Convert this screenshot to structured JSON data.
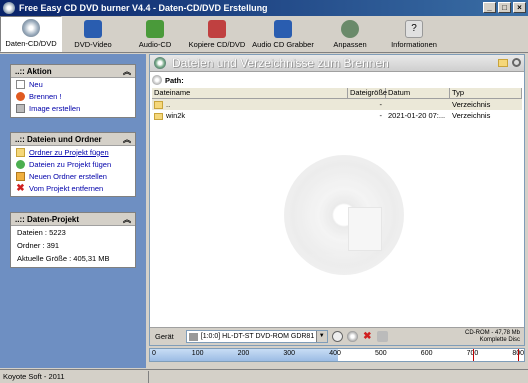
{
  "window": {
    "title": "Free Easy CD DVD burner V4.4 - Daten-CD/DVD Erstellung"
  },
  "toolbar": {
    "buttons": [
      {
        "label": "Daten-CD/DVD",
        "color": "#7a8fa8"
      },
      {
        "label": "DVD-Video",
        "color": "#2a5db0"
      },
      {
        "label": "Audio-CD",
        "color": "#4a9a3a"
      },
      {
        "label": "Kopiere CD/DVD",
        "color": "#c04040"
      },
      {
        "label": "Audio CD Grabber",
        "color": "#2a5db0"
      },
      {
        "label": "Anpassen",
        "color": "#6a8a6a"
      },
      {
        "label": "Informationen",
        "color": "#b0b0b0"
      }
    ]
  },
  "actions": {
    "title": "..:: Aktion",
    "items": [
      {
        "label": "Neu"
      },
      {
        "label": "Brennen !"
      },
      {
        "label": "Image erstellen"
      }
    ]
  },
  "files_folders": {
    "title": "..:: Dateien und Ordner",
    "items": [
      {
        "label": "Ordner zu Projekt fügen"
      },
      {
        "label": "Dateien zu Projekt fügen"
      },
      {
        "label": "Neuen Ordner erstellen"
      },
      {
        "label": "Vom Projekt entfernen"
      }
    ]
  },
  "project": {
    "title": "..:: Daten-Projekt",
    "files": "Dateien : 5223",
    "folders": "Ordner : 391",
    "size": "Aktuelle Größe : 405,31 MB"
  },
  "main": {
    "title": "Dateien und Verzeichnisse zum Brennen",
    "path_label": "Path:",
    "columns": [
      "Dateiname",
      "Dateigröße",
      "Datum",
      "Typ"
    ],
    "rows": [
      {
        "name": "..",
        "size": "-",
        "date": "",
        "type": "Verzeichnis"
      },
      {
        "name": "win2k",
        "size": "-",
        "date": "2021-01-20 07:...",
        "type": "Verzeichnis"
      }
    ]
  },
  "device": {
    "label": "Gerät",
    "selected": "[1:0:0] HL-DT-ST DVD-ROM GDR81",
    "info_line1": "CD-ROM - 47,78 Mb",
    "info_line2": "Komplette Disc"
  },
  "capacity": {
    "ticks": [
      "0",
      "100",
      "200",
      "300",
      "400",
      "500",
      "600",
      "700",
      "800"
    ],
    "used_mb": 405.31,
    "max_mb": 870
  },
  "status": {
    "text": "Koyote Soft - 2011"
  }
}
